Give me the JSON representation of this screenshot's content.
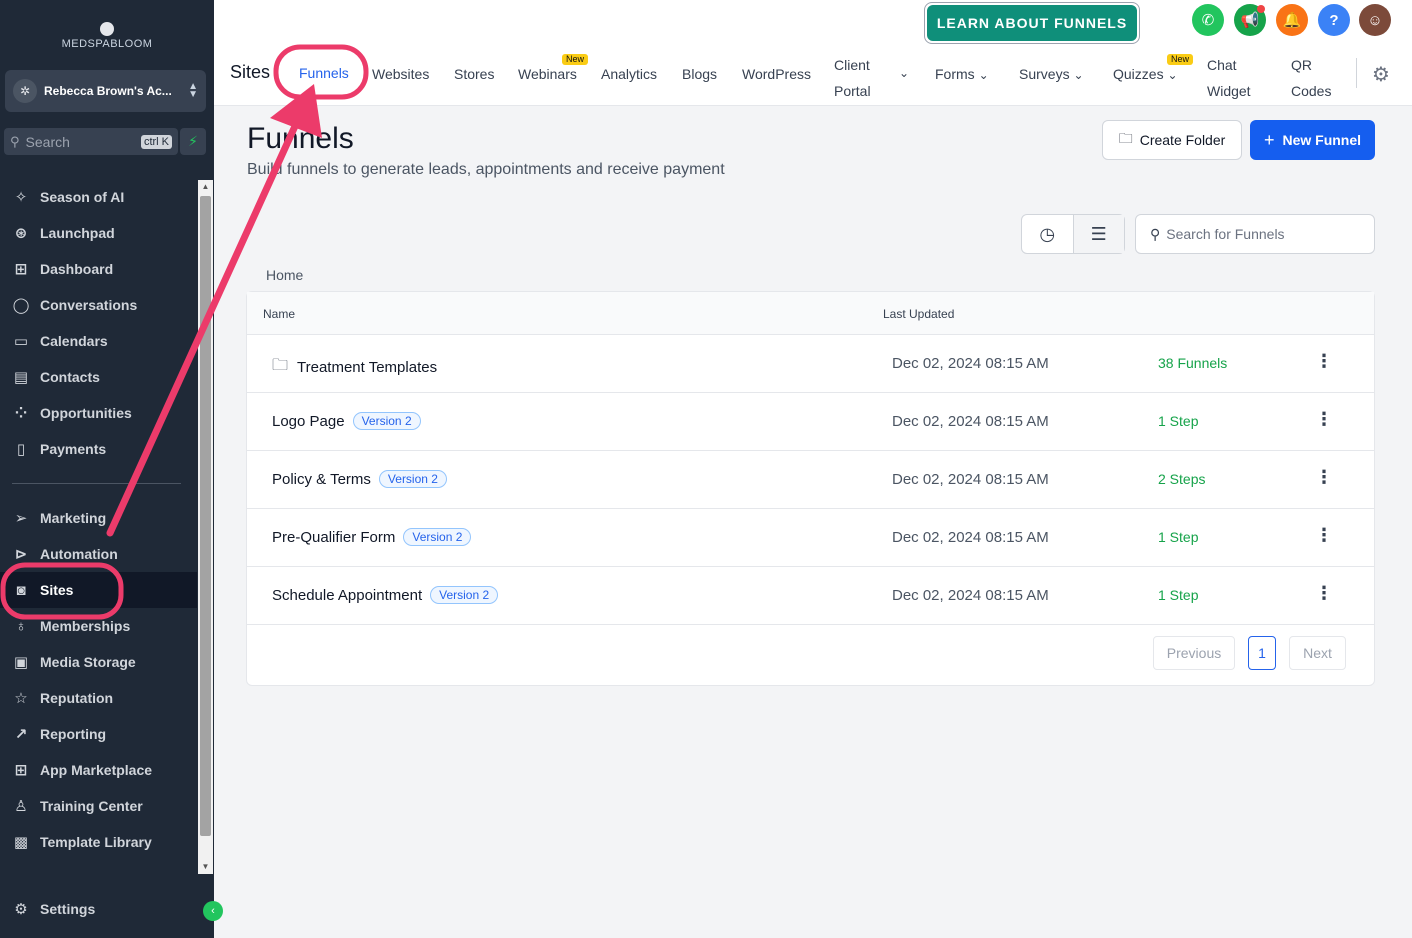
{
  "sidebar": {
    "logo": "MEDSPABLOOM",
    "account_name": "Rebecca Brown's Ac...",
    "search_placeholder": "Search",
    "search_shortcut": "ctrl K",
    "items": [
      {
        "label": "Season of AI",
        "icon": "sparkle-icon"
      },
      {
        "label": "Launchpad",
        "icon": "rocket-icon"
      },
      {
        "label": "Dashboard",
        "icon": "grid-icon"
      },
      {
        "label": "Conversations",
        "icon": "chat-icon"
      },
      {
        "label": "Calendars",
        "icon": "calendar-icon"
      },
      {
        "label": "Contacts",
        "icon": "contacts-icon"
      },
      {
        "label": "Opportunities",
        "icon": "opportunities-icon"
      },
      {
        "label": "Payments",
        "icon": "payments-icon"
      },
      {
        "label": "Marketing",
        "icon": "send-icon"
      },
      {
        "label": "Automation",
        "icon": "automation-icon"
      },
      {
        "label": "Sites",
        "icon": "globe-icon"
      },
      {
        "label": "Memberships",
        "icon": "badge-icon"
      },
      {
        "label": "Media Storage",
        "icon": "image-icon"
      },
      {
        "label": "Reputation",
        "icon": "star-icon"
      },
      {
        "label": "Reporting",
        "icon": "trend-icon"
      },
      {
        "label": "App Marketplace",
        "icon": "apps-icon"
      },
      {
        "label": "Training Center",
        "icon": "training-icon"
      },
      {
        "label": "Template Library",
        "icon": "template-icon"
      }
    ],
    "settings_label": "Settings"
  },
  "topbar": {
    "section": "Sites",
    "tabs": {
      "funnels": "Funnels",
      "websites": "Websites",
      "stores": "Stores",
      "webinars": "Webinars",
      "analytics": "Analytics",
      "blogs": "Blogs",
      "wordpress": "WordPress",
      "client_portal_1": "Client",
      "client_portal_2": "Portal",
      "forms": "Forms",
      "surveys": "Surveys",
      "quizzes": "Quizzes",
      "chat_widget_1": "Chat",
      "chat_widget_2": "Widget",
      "qr_codes_1": "QR",
      "qr_codes_2": "Codes"
    },
    "new_badge": "New",
    "learn_button": "LEARN ABOUT FUNNELS",
    "help_label": "?"
  },
  "main": {
    "title": "Funnels",
    "subtitle": "Build funnels to generate leads, appointments and receive payment",
    "create_folder": "Create Folder",
    "new_funnel": "New Funnel",
    "search_placeholder": "Search for Funnels",
    "breadcrumb": "Home",
    "table": {
      "col_name": "Name",
      "col_updated": "Last Updated",
      "rows": [
        {
          "name": "Treatment Templates",
          "version": "",
          "updated": "Dec 02, 2024 08:15 AM",
          "steps": "38 Funnels",
          "folder": true
        },
        {
          "name": "Logo Page",
          "version": "Version 2",
          "updated": "Dec 02, 2024 08:15 AM",
          "steps": "1 Step"
        },
        {
          "name": "Policy & Terms",
          "version": "Version 2",
          "updated": "Dec 02, 2024 08:15 AM",
          "steps": "2 Steps"
        },
        {
          "name": "Pre-Qualifier Form",
          "version": "Version 2",
          "updated": "Dec 02, 2024 08:15 AM",
          "steps": "1 Step"
        },
        {
          "name": "Schedule Appointment",
          "version": "Version 2",
          "updated": "Dec 02, 2024 08:15 AM",
          "steps": "1 Step"
        }
      ]
    },
    "pagination": {
      "previous": "Previous",
      "current": "1",
      "next": "Next"
    }
  },
  "colors": {
    "accent": "#155eef",
    "sidebar_bg": "#1f2937",
    "annotation": "#ec3b6a",
    "success": "#16a34a"
  }
}
